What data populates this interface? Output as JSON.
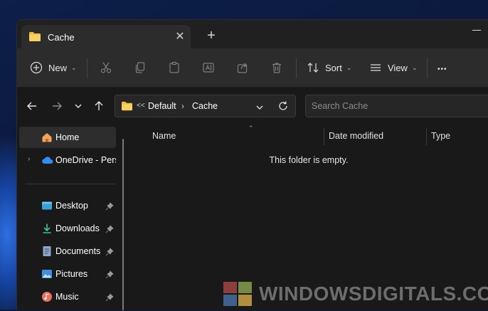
{
  "window": {
    "tab_title": "Cache",
    "new_tab_label": "+",
    "close_tab_label": "✕"
  },
  "toolbar": {
    "new_label": "New",
    "sort_label": "Sort",
    "view_label": "View",
    "more_label": "•••"
  },
  "address": {
    "overflow": "<<",
    "crumbs": [
      "Default",
      "Cache"
    ],
    "search_placeholder": "Search Cache"
  },
  "sidebar": {
    "items": [
      {
        "label": "Home",
        "icon": "home-icon",
        "selected": true
      },
      {
        "label": "OneDrive - Personal",
        "icon": "cloud-icon",
        "expandable": true
      },
      {
        "label": "Desktop",
        "icon": "desktop-icon",
        "pinned": true
      },
      {
        "label": "Downloads",
        "icon": "download-icon",
        "pinned": true
      },
      {
        "label": "Documents",
        "icon": "document-icon",
        "pinned": true
      },
      {
        "label": "Pictures",
        "icon": "picture-icon",
        "pinned": true
      },
      {
        "label": "Music",
        "icon": "music-icon",
        "pinned": true
      }
    ]
  },
  "content": {
    "columns": [
      "Name",
      "Date modified",
      "Type"
    ],
    "empty_message": "This folder is empty."
  },
  "watermark": {
    "text": "WINDOWSDIGITALS.COM"
  },
  "colors": {
    "accent_folder": "#f3c03b",
    "window_bg": "#191919",
    "toolbar_bg": "#2c2c2c"
  }
}
